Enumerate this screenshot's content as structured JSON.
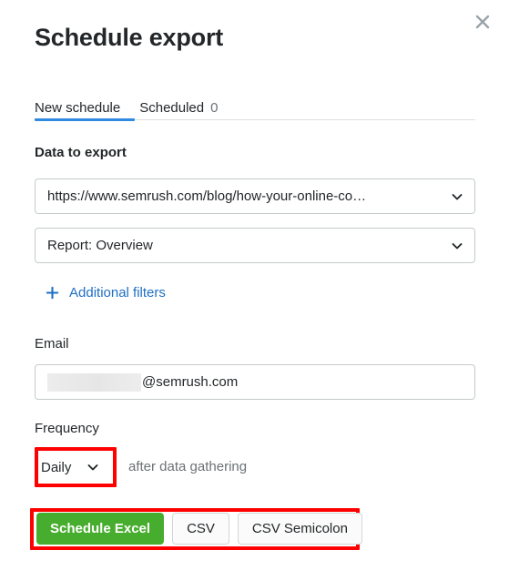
{
  "modal": {
    "title": "Schedule export",
    "close_label": "close-icon"
  },
  "tabs": {
    "items": [
      {
        "label": "New schedule",
        "count": "",
        "active": true
      },
      {
        "label": "Scheduled",
        "count": "0",
        "active": false
      }
    ]
  },
  "data_to_export": {
    "section_label": "Data to export",
    "url_select": {
      "value": "https://www.semrush.com/blog/how-your-online-co…",
      "icon": "chevron-down-icon"
    },
    "report_select": {
      "value": "Report: Overview",
      "icon": "chevron-down-icon"
    },
    "additional_filters": {
      "label": "Additional filters",
      "icon": "plus-icon"
    }
  },
  "email": {
    "label": "Email",
    "redacted": "",
    "domain": "@semrush.com"
  },
  "frequency": {
    "label": "Frequency",
    "value": "Daily",
    "icon": "chevron-down-icon",
    "note": "after data gathering"
  },
  "actions": {
    "primary": "Schedule Excel",
    "csv": "CSV",
    "csv_semicolon": "CSV Semicolon"
  },
  "colors": {
    "accent_blue": "#2f8ae0",
    "link_blue": "#1f6fc4",
    "primary_green": "#47ad2e",
    "highlight_red": "#fe0000",
    "text_dark": "#232729",
    "text_muted": "#6b7275",
    "border": "#c5cacc"
  }
}
